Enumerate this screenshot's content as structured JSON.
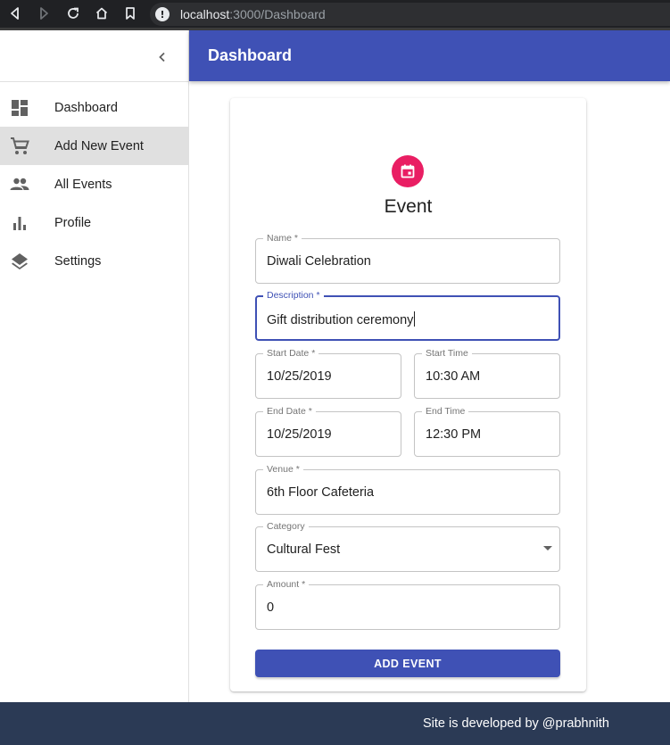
{
  "browser": {
    "url_host": "localhost",
    "url_path": ":3000/Dashboard",
    "info_glyph": "!",
    "icons": [
      "back-icon",
      "forward-icon",
      "reload-icon",
      "home-icon",
      "bookmark-icon",
      "info-icon"
    ]
  },
  "sidebar": {
    "collapse_icon": "chevron-left-icon",
    "items": [
      {
        "label": "Dashboard",
        "icon": "dashboard-icon",
        "active": false
      },
      {
        "label": "Add New Event",
        "icon": "cart-icon",
        "active": true
      },
      {
        "label": "All Events",
        "icon": "people-icon",
        "active": false
      },
      {
        "label": "Profile",
        "icon": "bar-chart-icon",
        "active": false
      },
      {
        "label": "Settings",
        "icon": "layers-icon",
        "active": false
      }
    ]
  },
  "header": {
    "title": "Dashboard"
  },
  "form": {
    "avatar_icon": "calendar-icon",
    "title": "Event",
    "fields": {
      "name": {
        "label": "Name *",
        "value": "Diwali Celebration"
      },
      "description": {
        "label": "Description *",
        "value": "Gift distribution ceremony"
      },
      "start_date": {
        "label": "Start Date *",
        "value": "10/25/2019"
      },
      "start_time": {
        "label": "Start Time",
        "value": "10:30 AM"
      },
      "end_date": {
        "label": "End Date *",
        "value": "10/25/2019"
      },
      "end_time": {
        "label": "End Time",
        "value": "12:30 PM"
      },
      "venue": {
        "label": "Venue *",
        "value": "6th Floor Cafeteria"
      },
      "category": {
        "label": "Category",
        "value": "Cultural Fest"
      },
      "amount": {
        "label": "Amount *",
        "value": "0"
      }
    },
    "submit_label": "ADD EVENT"
  },
  "footer": {
    "text": "Site is developed by @prabhnith"
  },
  "colors": {
    "primary": "#3f51b5",
    "accent": "#e91e63",
    "footer_bg": "#2b3a55",
    "active_item_bg": "#e0e0e0"
  }
}
